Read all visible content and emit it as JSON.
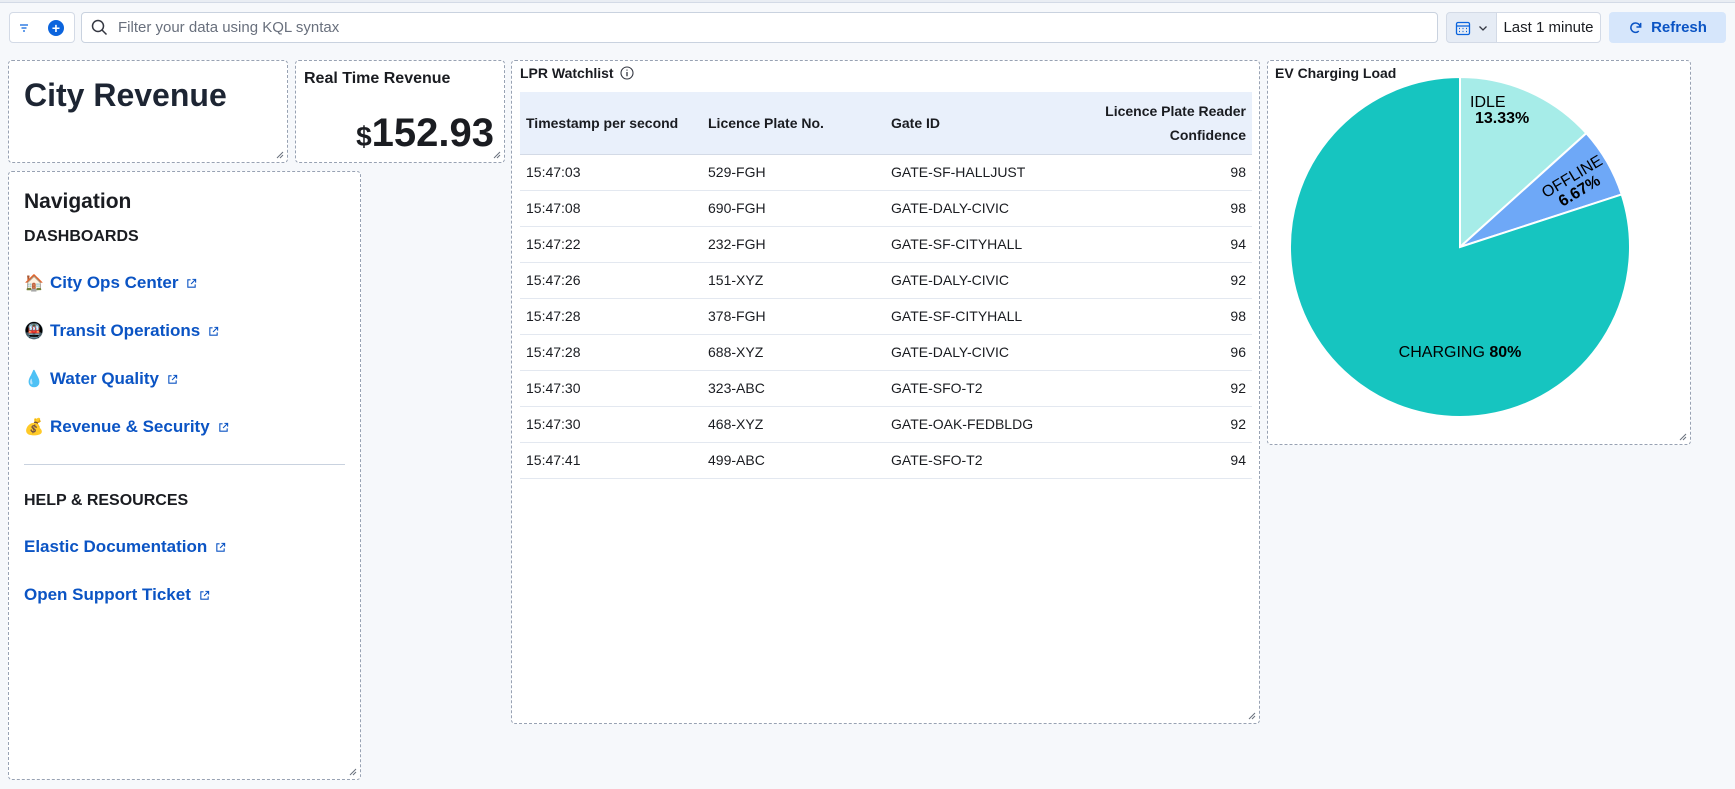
{
  "query_bar": {
    "search_placeholder": "Filter your data using KQL syntax",
    "time_range": "Last 1 minute",
    "refresh_label": "Refresh"
  },
  "city_revenue": {
    "title": "City Revenue"
  },
  "real_time_revenue": {
    "title": "Real Time Revenue",
    "currency": "$",
    "value": "152.93"
  },
  "navigation": {
    "title": "Navigation",
    "dashboards_heading": "DASHBOARDS",
    "dashboards": [
      {
        "emoji": "🏠",
        "label": "City Ops Center"
      },
      {
        "emoji": "🚇",
        "label": "Transit Operations"
      },
      {
        "emoji": "💧",
        "label": "Water Quality"
      },
      {
        "emoji": "💰",
        "label": "Revenue & Security"
      }
    ],
    "help_heading": "HELP & RESOURCES",
    "help": [
      {
        "label": "Elastic Documentation"
      },
      {
        "label": "Open Support Ticket"
      }
    ]
  },
  "lpr": {
    "title": "LPR Watchlist",
    "columns": [
      "Timestamp per second",
      "Licence Plate No.",
      "Gate ID",
      "Licence Plate Reader Confidence"
    ],
    "rows": [
      [
        "15:47:03",
        "529-FGH",
        "GATE-SF-HALLJUST",
        "98"
      ],
      [
        "15:47:08",
        "690-FGH",
        "GATE-DALY-CIVIC",
        "98"
      ],
      [
        "15:47:22",
        "232-FGH",
        "GATE-SF-CITYHALL",
        "94"
      ],
      [
        "15:47:26",
        "151-XYZ",
        "GATE-DALY-CIVIC",
        "92"
      ],
      [
        "15:47:28",
        "378-FGH",
        "GATE-SF-CITYHALL",
        "98"
      ],
      [
        "15:47:28",
        "688-XYZ",
        "GATE-DALY-CIVIC",
        "96"
      ],
      [
        "15:47:30",
        "323-ABC",
        "GATE-SFO-T2",
        "92"
      ],
      [
        "15:47:30",
        "468-XYZ",
        "GATE-OAK-FEDBLDG",
        "92"
      ],
      [
        "15:47:41",
        "499-ABC",
        "GATE-SFO-T2",
        "94"
      ]
    ]
  },
  "chart_data": {
    "type": "pie",
    "title": "EV Charging Load",
    "slices": [
      {
        "label": "IDLE",
        "pct_label": "13.33%",
        "value": 13.33,
        "color": "#a6ece8"
      },
      {
        "label": "OFFLINE",
        "pct_label": "6.67%",
        "value": 6.67,
        "color": "#6ea8f7"
      },
      {
        "label": "CHARGING",
        "pct_label": "80%",
        "value": 80,
        "color": "#16c5c0"
      }
    ]
  },
  "colors": {
    "link": "#0b54c4",
    "accent": "#0b64dd",
    "refresh_bg": "#d6e6fb"
  }
}
